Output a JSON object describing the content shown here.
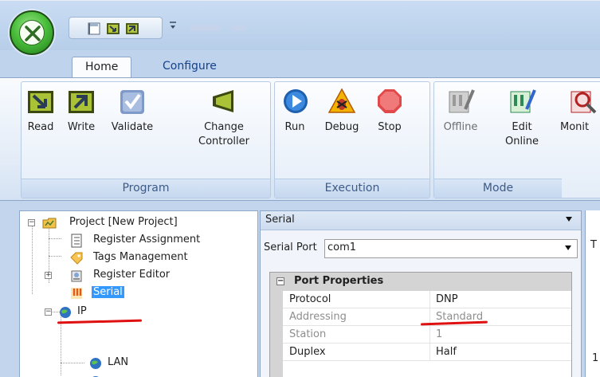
{
  "qat": {
    "icons": [
      "save-icon",
      "read-small-icon",
      "write-small-icon",
      "dropdown-arrow-icon"
    ]
  },
  "tabs": [
    {
      "label": "Home",
      "active": true
    },
    {
      "label": "Configure",
      "active": false
    }
  ],
  "ribbon": {
    "program": {
      "label": "Program",
      "buttons": [
        {
          "label": "Read",
          "icon": "read-icon"
        },
        {
          "label": "Write",
          "icon": "write-icon"
        },
        {
          "label": "Validate",
          "icon": "validate-icon"
        },
        {
          "label_line1": "Change",
          "label_line2": "Controller",
          "icon": "change-controller-icon"
        }
      ]
    },
    "execution": {
      "label": "Execution",
      "buttons": [
        {
          "label": "Run",
          "icon": "run-icon"
        },
        {
          "label": "Debug",
          "icon": "debug-icon"
        },
        {
          "label": "Stop",
          "icon": "stop-icon"
        }
      ]
    },
    "mode": {
      "label": "Mode",
      "buttons": [
        {
          "label": "Offline",
          "icon": "offline-icon",
          "disabled": true
        },
        {
          "label_line1": "Edit",
          "label_line2": "Online",
          "icon": "edit-online-icon"
        },
        {
          "label": "Monit",
          "icon": "monitor-icon"
        }
      ]
    }
  },
  "tree": {
    "items": [
      {
        "label": "Project [New Project]",
        "icon": "folder-project-icon",
        "expander": "−"
      },
      {
        "label": "Register Assignment",
        "icon": "document-list-icon"
      },
      {
        "label": "Tags Management",
        "icon": "tag-icon"
      },
      {
        "label": "Register Editor",
        "icon": "register-editor-icon",
        "expander": "+"
      },
      {
        "label": "Serial",
        "icon": "serial-port-icon",
        "selected": true
      },
      {
        "label": "IP",
        "icon": "globe-icon",
        "expander": "−"
      },
      {
        "label": "LAN",
        "icon": "globe-lan-icon"
      }
    ]
  },
  "props": {
    "header": "Serial",
    "serial_port_label": "Serial Port",
    "serial_port_value": "com1",
    "category": "Port Properties",
    "rows": [
      {
        "key": "Protocol",
        "value": "DNP",
        "dim": false
      },
      {
        "key": "Addressing",
        "value": "Standard",
        "dim": true
      },
      {
        "key": "Station",
        "value": "1",
        "dim": true
      },
      {
        "key": "Duplex",
        "value": "Half",
        "dim": false
      }
    ]
  },
  "right_strip": {
    "letter": "T",
    "digit": "1"
  },
  "colors": {
    "accent_blue": "#15428b",
    "selection": "#3399ff",
    "annotation_red": "#e01010"
  }
}
